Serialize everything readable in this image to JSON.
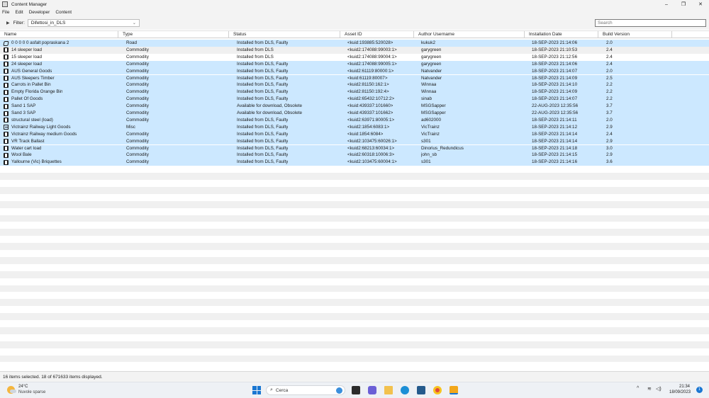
{
  "window": {
    "title": "Content Manager",
    "minimize": "–",
    "restore": "❐",
    "close": "✕"
  },
  "menu": [
    "File",
    "Edit",
    "Developer",
    "Content"
  ],
  "filter": {
    "label": "Filter:",
    "value": "Difettosi_in_DLS",
    "search_placeholder": "Search"
  },
  "columns": [
    "Name",
    "Type",
    "Status",
    "Asset ID",
    "Author Username",
    "Installation Date",
    "Build Version"
  ],
  "rows": [
    {
      "name": "0 0 0 0 0 asfalt popraskana 2",
      "type": "Road",
      "status": "Installed from DLS, Faulty",
      "asset_id": "<kuid:193885:520028>",
      "author": "kukuk2",
      "date": "18-SEP-2023 21:14:06",
      "build": "2.0",
      "selected": true,
      "icon": "road-icon"
    },
    {
      "name": "14 sleeper load",
      "type": "Commodity",
      "status": "Installed from DLS",
      "asset_id": "<kuid2:174088:99003:1>",
      "author": "garygreen",
      "date": "18-SEP-2023 21:10:53",
      "build": "2.4",
      "selected": false,
      "icon": "commodity-icon"
    },
    {
      "name": "15 sleeper load",
      "type": "Commodity",
      "status": "Installed from DLS",
      "asset_id": "<kuid2:174088:99004:1>",
      "author": "garygreen",
      "date": "18-SEP-2023 21:12:56",
      "build": "2.4",
      "selected": false,
      "icon": "commodity-icon"
    },
    {
      "name": "24 sleeper load",
      "type": "Commodity",
      "status": "Installed from DLS, Faulty",
      "asset_id": "<kuid2:174088:99005:1>",
      "author": "garygreen",
      "date": "18-SEP-2023 21:14:06",
      "build": "2.4",
      "selected": true,
      "icon": "commodity-icon"
    },
    {
      "name": "AUS General Goods",
      "type": "Commodity",
      "status": "Installed from DLS, Faulty",
      "asset_id": "<kuid2:61119:80000:1>",
      "author": "Natvander",
      "date": "18-SEP-2023 21:14:07",
      "build": "2.0",
      "selected": true,
      "icon": "commodity-icon"
    },
    {
      "name": "AUS Sleepers Timber",
      "type": "Commodity",
      "status": "Installed from DLS, Faulty",
      "asset_id": "<kuid:61119:80007>",
      "author": "Natvander",
      "date": "18-SEP-2023 21:14:09",
      "build": "2.5",
      "selected": true,
      "icon": "commodity-icon"
    },
    {
      "name": "Carrots in Pallet Bin",
      "type": "Commodity",
      "status": "Installed from DLS, Faulty",
      "asset_id": "<kuid2:81150:162:1>",
      "author": "Winnaa",
      "date": "18-SEP-2023 21:14:10",
      "build": "2.2",
      "selected": true,
      "icon": "commodity-icon"
    },
    {
      "name": "Empty Florida Orange Bin",
      "type": "Commodity",
      "status": "Installed from DLS, Faulty",
      "asset_id": "<kuid2:81150:192:4>",
      "author": "Winnaa",
      "date": "18-SEP-2023 21:14:09",
      "build": "2.2",
      "selected": true,
      "icon": "commodity-icon"
    },
    {
      "name": "Pallet Of Goods",
      "type": "Commodity",
      "status": "Installed from DLS, Faulty",
      "asset_id": "<kuid2:65432:10712:2>",
      "author": "sinab",
      "date": "18-SEP-2023 21:14:07",
      "build": "2.2",
      "selected": true,
      "icon": "commodity-icon"
    },
    {
      "name": "Sand 1 SAP",
      "type": "Commodity",
      "status": "Available for download, Obsolete",
      "asset_id": "<kuid:439337:101660>",
      "author": "MSGSapper",
      "date": "22-AUG-2023 12:35:56",
      "build": "3.7",
      "selected": true,
      "icon": "commodity-icon"
    },
    {
      "name": "Sand 3 SAP",
      "type": "Commodity",
      "status": "Available for download, Obsolete",
      "asset_id": "<kuid:439337:101662>",
      "author": "MSGSapper",
      "date": "22-AUG-2023 12:35:56",
      "build": "3.7",
      "selected": true,
      "icon": "commodity-icon"
    },
    {
      "name": "structural steel (load)",
      "type": "Commodity",
      "status": "Installed from DLS, Faulty",
      "asset_id": "<kuid2:63971:80005:1>",
      "author": "ad602000",
      "date": "18-SEP-2023 21:14:11",
      "build": "2.0",
      "selected": true,
      "icon": "commodity-icon"
    },
    {
      "name": "Victrainz Railway Light Goods",
      "type": "Misc",
      "status": "Installed from DLS, Faulty",
      "asset_id": "<kuid2:1854:6083:1>",
      "author": "VicTrainz",
      "date": "18-SEP-2023 21:14:12",
      "build": "2.9",
      "selected": true,
      "icon": "misc-icon"
    },
    {
      "name": "Victrainz Railway medium Goods",
      "type": "Commodity",
      "status": "Installed from DLS, Faulty",
      "asset_id": "<kuid:1854:6084>",
      "author": "VicTrainz",
      "date": "18-SEP-2023 21:14:14",
      "build": "2.4",
      "selected": true,
      "icon": "commodity-icon"
    },
    {
      "name": "VR Track Ballast",
      "type": "Commodity",
      "status": "Installed from DLS, Faulty",
      "asset_id": "<kuid2:103475:60026:1>",
      "author": "s301",
      "date": "18-SEP-2023 21:14:14",
      "build": "2.9",
      "selected": true,
      "icon": "commodity-icon"
    },
    {
      "name": "Water cart load",
      "type": "Commodity",
      "status": "Installed from DLS, Faulty",
      "asset_id": "<kuid2:68213:60034:1>",
      "author": "Dinorius_Redundicus",
      "date": "18-SEP-2023 21:14:18",
      "build": "3.0",
      "selected": true,
      "icon": "commodity-icon"
    },
    {
      "name": "Wool Bale",
      "type": "Commodity",
      "status": "Installed from DLS, Faulty",
      "asset_id": "<kuid2:60318:10006:3>",
      "author": "john_sb",
      "date": "18-SEP-2023 21:14:15",
      "build": "2.9",
      "selected": true,
      "icon": "commodity-icon"
    },
    {
      "name": "Yallourne (Vic) Briquettes",
      "type": "Commodity",
      "status": "Installed from DLS, Faulty",
      "asset_id": "<kuid2:103475:60004:1>",
      "author": "s301",
      "date": "18-SEP-2023 21:14:16",
      "build": "3.6",
      "selected": true,
      "icon": "commodity-icon"
    }
  ],
  "status_bar": "16 items selected. 18 of 671633 items displayed.",
  "taskbar": {
    "temperature": "24°C",
    "weather": "Nuvole sparse",
    "search_label": "Cerca",
    "time": "21:34",
    "date": "18/09/2023",
    "notification_count": "1"
  },
  "colors": {
    "selection": "#cce8ff",
    "stripe": "#f0f0f0"
  }
}
